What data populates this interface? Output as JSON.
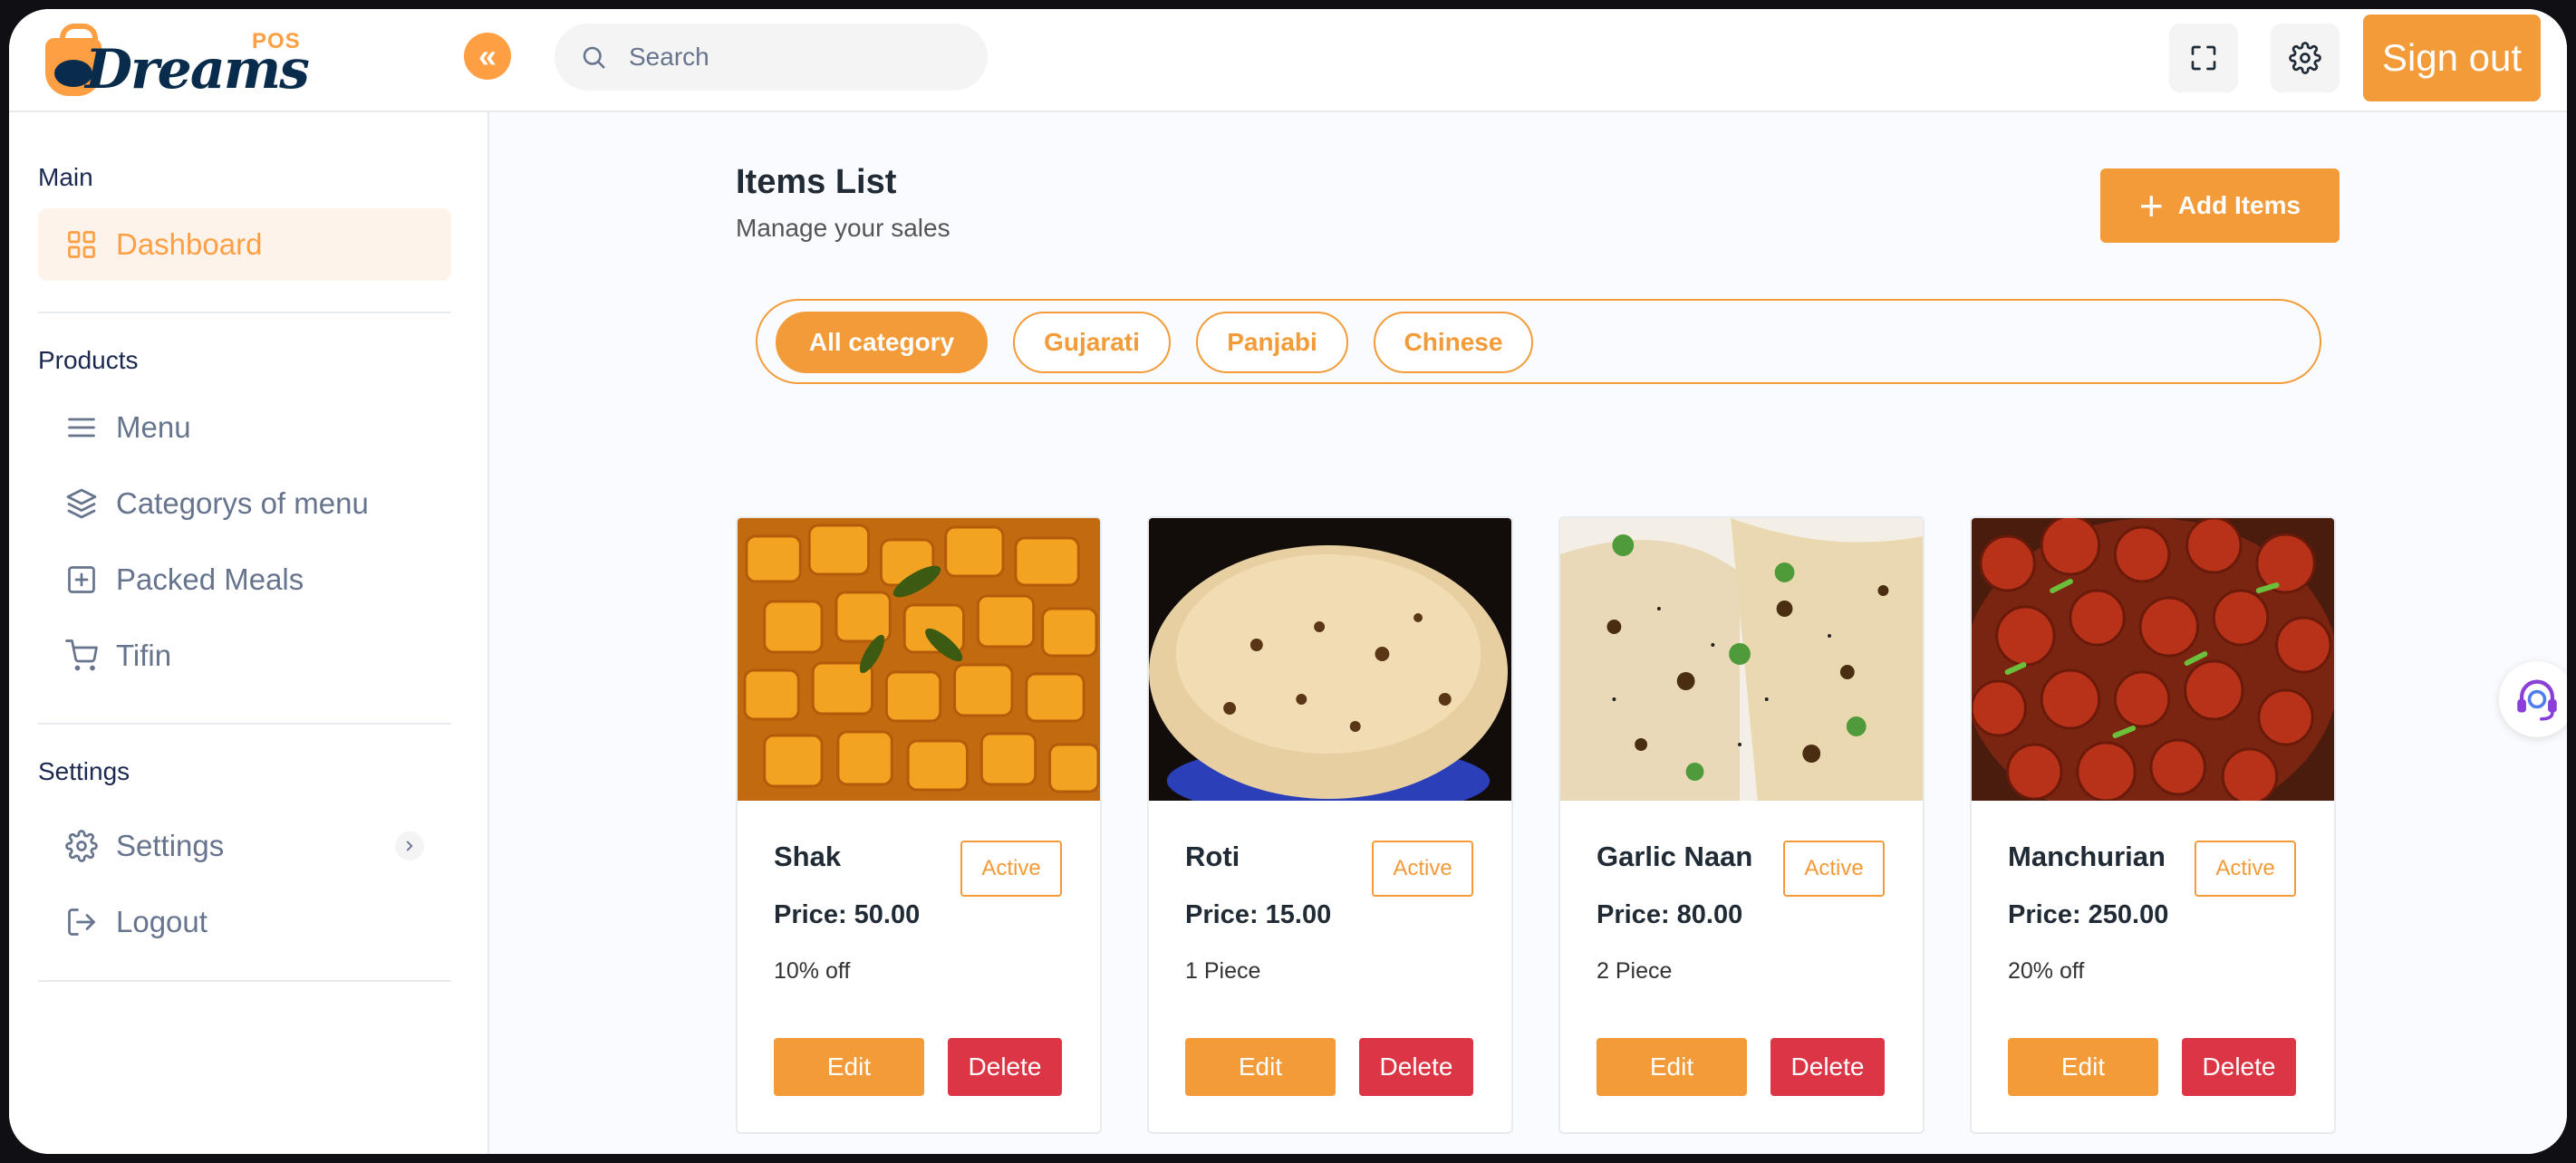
{
  "app": {
    "logo_text": "Dreams",
    "logo_suffix": "POS"
  },
  "header": {
    "search_placeholder": "Search",
    "signout_label": "Sign out",
    "icons": [
      "fullscreen-icon",
      "gear-icon"
    ]
  },
  "sidebar": {
    "sections": [
      {
        "title": "Main",
        "items": [
          {
            "label": "Dashboard",
            "icon": "grid-icon",
            "active": true
          }
        ]
      },
      {
        "title": "Products",
        "items": [
          {
            "label": "Menu",
            "icon": "menu-icon"
          },
          {
            "label": "Categorys of menu",
            "icon": "layers-icon"
          },
          {
            "label": "Packed Meals",
            "icon": "plus-square-icon"
          },
          {
            "label": "Tifin",
            "icon": "cart-icon"
          }
        ]
      },
      {
        "title": "Settings",
        "items": [
          {
            "label": "Settings",
            "icon": "gear-icon"
          },
          {
            "label": "Logout",
            "icon": "logout-icon"
          }
        ]
      }
    ]
  },
  "page": {
    "title": "Items List",
    "subtitle": "Manage your sales",
    "add_button": "Add Items"
  },
  "categories": [
    {
      "label": "All category",
      "active": true
    },
    {
      "label": "Gujarati",
      "active": false
    },
    {
      "label": "Panjabi",
      "active": false
    },
    {
      "label": "Chinese",
      "active": false
    }
  ],
  "items": [
    {
      "name": "Shak",
      "status": "Active",
      "price": "Price: 50.00",
      "note": "10% off",
      "edit": "Edit",
      "delete": "Delete"
    },
    {
      "name": "Roti",
      "status": "Active",
      "price": "Price: 15.00",
      "note": "1 Piece",
      "edit": "Edit",
      "delete": "Delete"
    },
    {
      "name": "Garlic Naan",
      "status": "Active",
      "price": "Price: 80.00",
      "note": "2 Piece",
      "edit": "Edit",
      "delete": "Delete"
    },
    {
      "name": "Manchurian",
      "status": "Active",
      "price": "Price: 250.00",
      "note": "20% off",
      "edit": "Edit",
      "delete": "Delete"
    }
  ],
  "colors": {
    "accent": "#f29b38",
    "danger": "#dc3545",
    "navy": "#092c4c"
  }
}
